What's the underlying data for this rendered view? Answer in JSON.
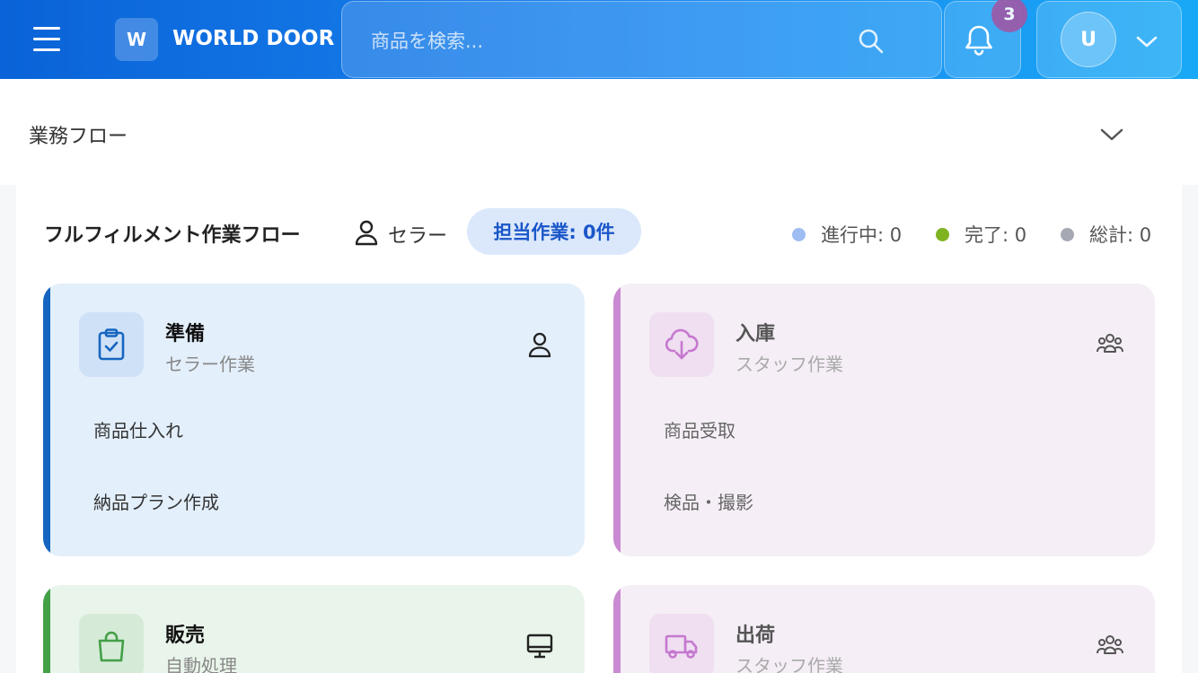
{
  "header": {
    "logo_letter": "W",
    "brand": "WORLD DOOR",
    "search_placeholder": "商品を検索...",
    "notification_count": "3",
    "avatar_letter": "U"
  },
  "section": {
    "title": "業務フロー"
  },
  "flow": {
    "title": "フルフィルメント作業フロー",
    "role": "セラー",
    "assigned": "担当作業: 0件",
    "stats": [
      {
        "label": "進行中: 0",
        "color": "#9dbdf3"
      },
      {
        "label": "完了: 0",
        "color": "#7fb322"
      },
      {
        "label": "総計: 0",
        "color": "#a6a9b3"
      }
    ]
  },
  "cards": [
    {
      "title": "準備",
      "subtitle": "セラー作業",
      "icon": "clipboard-check-icon",
      "corner_icon": "person-icon",
      "steps": [
        "商品仕入れ",
        "納品プラン作成"
      ],
      "accent": "#1565c0",
      "bg": "#e3effb",
      "icon_bg": "#cfe1f6"
    },
    {
      "title": "入庫",
      "subtitle": "スタッフ作業",
      "icon": "cloud-download-icon",
      "corner_icon": "group-icon",
      "steps": [
        "商品受取",
        "検品・撮影"
      ],
      "accent": "#c98ad1",
      "bg": "#f5eef6",
      "icon_bg": "#efdff1"
    },
    {
      "title": "販売",
      "subtitle": "自動処理",
      "icon": "shopping-bag-icon",
      "corner_icon": "monitor-icon",
      "steps": [],
      "accent": "#43a047",
      "bg": "#e9f4ea",
      "icon_bg": "#d5ebd7"
    },
    {
      "title": "出荷",
      "subtitle": "スタッフ作業",
      "icon": "truck-icon",
      "corner_icon": "group-icon",
      "steps": [],
      "accent": "#c98ad1",
      "bg": "#f5eef6",
      "icon_bg": "#efdff1"
    }
  ]
}
